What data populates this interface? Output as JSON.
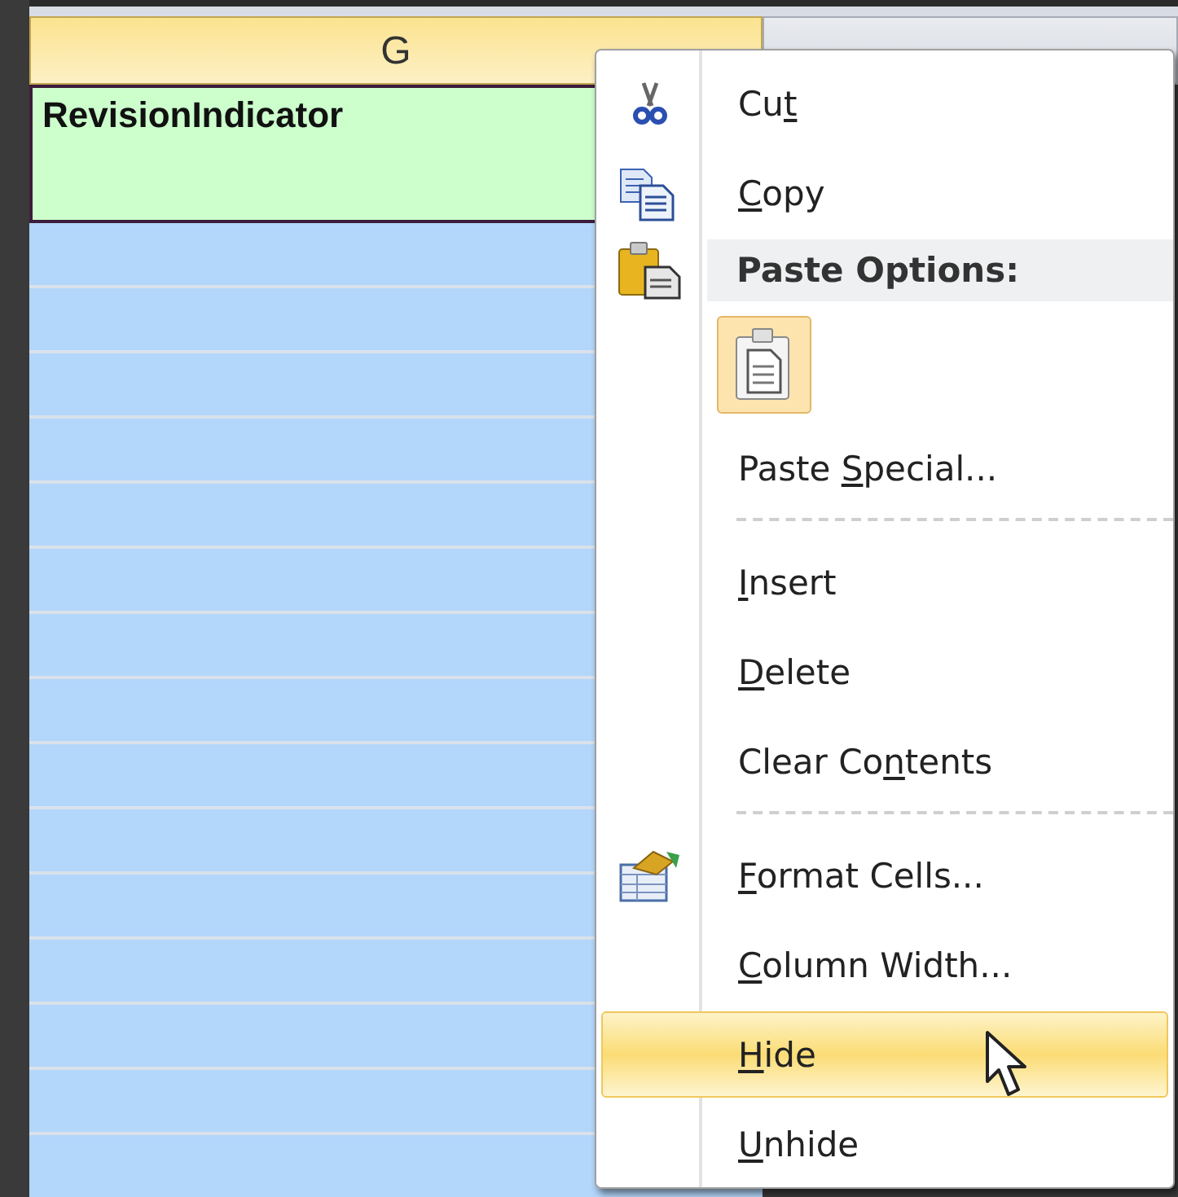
{
  "sheet": {
    "columns": [
      {
        "header": "G",
        "selected": true
      },
      {
        "selected": false
      }
    ],
    "cell": {
      "text": "RevisionIndicator"
    }
  },
  "context_menu": {
    "items": [
      {
        "kind": "command",
        "before": "Cu",
        "key": "t",
        "selected": false
      },
      {
        "kind": "command",
        "key": "C",
        "after": "opy",
        "selected": false
      },
      {
        "kind": "heading",
        "label": "Paste Options:"
      },
      {
        "kind": "paste_option",
        "selected": true
      },
      {
        "kind": "command",
        "before": "Paste ",
        "key": "S",
        "after": "pecial...",
        "selected": false
      },
      {
        "kind": "separator"
      },
      {
        "kind": "command",
        "key": "I",
        "after": "nsert",
        "selected": false
      },
      {
        "kind": "command",
        "key": "D",
        "after": "elete",
        "selected": false
      },
      {
        "kind": "command",
        "before": "Clear Co",
        "key": "n",
        "after": "tents",
        "selected": false
      },
      {
        "kind": "separator"
      },
      {
        "kind": "command",
        "key": "F",
        "after": "ormat Cells...",
        "selected": false
      },
      {
        "kind": "command",
        "key": "C",
        "after": "olumn Width...",
        "selected": false
      },
      {
        "kind": "command",
        "key": "H",
        "after": "ide",
        "selected": true
      },
      {
        "kind": "command",
        "key": "U",
        "after": "nhide",
        "selected": false
      }
    ]
  }
}
